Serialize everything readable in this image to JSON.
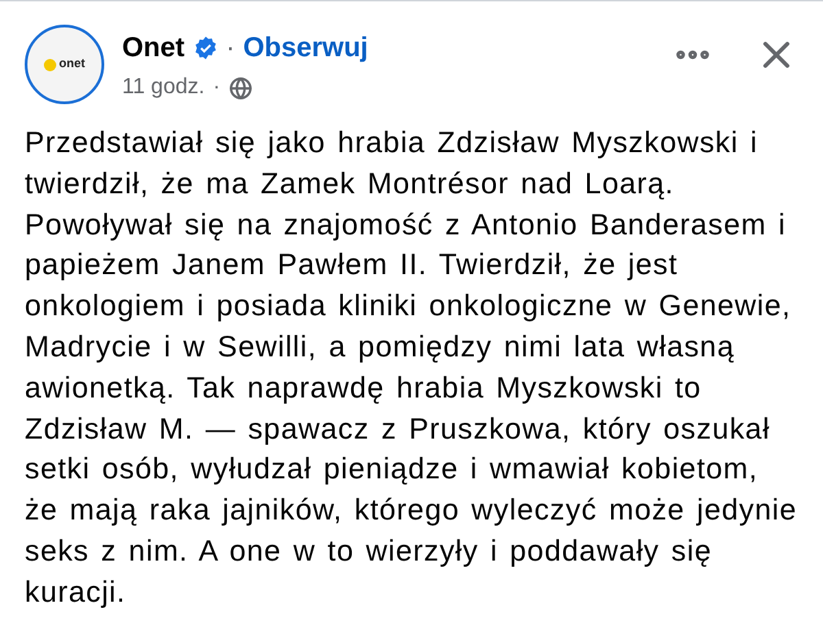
{
  "post": {
    "author": "Onet",
    "verified": true,
    "avatar_text": "onet",
    "follow_link": "Obserwuj",
    "separator": "·",
    "time": "11 godz.",
    "time_separator": "·",
    "body": "Przedstawiał się jako hrabia Zdzisław Myszkowski i twierdził, że ma Zamek Montrésor nad Loarą. Powoływał się na znajomość z Antonio Banderasem i papieżem Janem Pawłem II. Twierdził, że jest onkologiem i posiada kliniki onkologiczne w Genewie, Madrycie i w Sewilli, a pomiędzy nimi lata własną awionetką. Tak naprawdę hrabia Myszkowski to Zdzisław M. — spawacz z Pruszkowa, który oszukał setki osób, wyłudzał pieniądze i wmawiał kobietom, że mają raka jajników, którego wyleczyć może jedynie seks z nim. A one w to wierzyły i poddawały się kuracji."
  }
}
